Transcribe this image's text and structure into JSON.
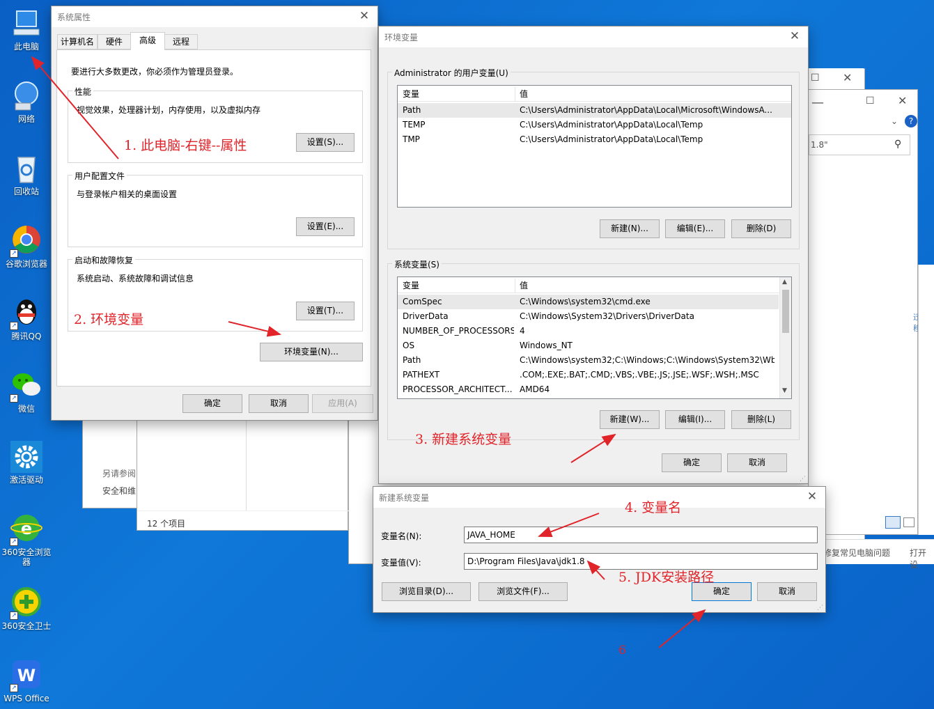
{
  "desktop": {
    "icons": [
      {
        "label": "此电脑",
        "icon": "computer-icon"
      },
      {
        "label": "网络",
        "icon": "network-icon"
      },
      {
        "label": "回收站",
        "icon": "recycle-bin-icon"
      },
      {
        "label": "谷歌浏览器",
        "icon": "chrome-icon"
      },
      {
        "label": "腾讯QQ",
        "icon": "qq-icon"
      },
      {
        "label": "微信",
        "icon": "wechat-icon"
      },
      {
        "label": "激活驱动",
        "icon": "gear-icon"
      },
      {
        "label": "360安全浏览器",
        "icon": "360-browser-icon"
      },
      {
        "label": "360安全卫士",
        "icon": "360-safe-icon"
      },
      {
        "label": "WPS Office",
        "icon": "wps-icon"
      }
    ]
  },
  "background_windows": {
    "see_also": "另请参阅",
    "security": "安全和维",
    "item_count": "12 个项目",
    "search_text": "1.8\"",
    "fix_problems": "修复常见电脑问题",
    "open_settings": "打开设",
    "side_text": "迁移"
  },
  "sys_props": {
    "title": "系统属性",
    "tabs": [
      "计算机名",
      "硬件",
      "高级",
      "远程"
    ],
    "admin_note": "要进行大多数更改，你必须作为管理员登录。",
    "performance": {
      "title": "性能",
      "desc": "视觉效果，处理器计划，内存使用，以及虚拟内存",
      "button": "设置(S)..."
    },
    "profile": {
      "title": "用户配置文件",
      "desc": "与登录帐户相关的桌面设置",
      "button": "设置(E)..."
    },
    "startup": {
      "title": "启动和故障恢复",
      "desc": "系统启动、系统故障和调试信息",
      "button": "设置(T)..."
    },
    "env_button": "环境变量(N)...",
    "ok": "确定",
    "cancel": "取消",
    "apply": "应用(A)"
  },
  "env_vars": {
    "title": "环境变量",
    "user_group": "Administrator 的用户变量(U)",
    "col_var": "变量",
    "col_val": "值",
    "user_rows": [
      {
        "name": "Path",
        "value": "C:\\Users\\Administrator\\AppData\\Local\\Microsoft\\WindowsA..."
      },
      {
        "name": "TEMP",
        "value": "C:\\Users\\Administrator\\AppData\\Local\\Temp"
      },
      {
        "name": "TMP",
        "value": "C:\\Users\\Administrator\\AppData\\Local\\Temp"
      }
    ],
    "user_new": "新建(N)...",
    "user_edit": "编辑(E)...",
    "user_delete": "删除(D)",
    "sys_group": "系统变量(S)",
    "sys_rows": [
      {
        "name": "ComSpec",
        "value": "C:\\Windows\\system32\\cmd.exe"
      },
      {
        "name": "DriverData",
        "value": "C:\\Windows\\System32\\Drivers\\DriverData"
      },
      {
        "name": "NUMBER_OF_PROCESSORS",
        "value": "4"
      },
      {
        "name": "OS",
        "value": "Windows_NT"
      },
      {
        "name": "Path",
        "value": "C:\\Windows\\system32;C:\\Windows;C:\\Windows\\System32\\Wb..."
      },
      {
        "name": "PATHEXT",
        "value": ".COM;.EXE;.BAT;.CMD;.VBS;.VBE;.JS;.JSE;.WSF;.WSH;.MSC"
      },
      {
        "name": "PROCESSOR_ARCHITECT...",
        "value": "AMD64"
      }
    ],
    "sys_new": "新建(W)...",
    "sys_edit": "编辑(I)...",
    "sys_delete": "删除(L)",
    "ok": "确定",
    "cancel": "取消"
  },
  "new_var": {
    "title": "新建系统变量",
    "name_label": "变量名(N):",
    "name_value": "JAVA_HOME",
    "value_label": "变量值(V):",
    "value_value": "D:\\Program Files\\Java\\jdk1.8",
    "browse_dir": "浏览目录(D)...",
    "browse_file": "浏览文件(F)...",
    "ok": "确定",
    "cancel": "取消"
  },
  "annotations": {
    "step1": "1. 此电脑-右键--属性",
    "step2": "2. 环境变量",
    "step3": "3. 新建系统变量",
    "step4": "4. 变量名",
    "step5": "5. JDK安装路径",
    "step6": "6"
  },
  "colors": {
    "annotation": "#e0242a",
    "desktop": "#0f78d8",
    "accent": "#0078d7"
  }
}
